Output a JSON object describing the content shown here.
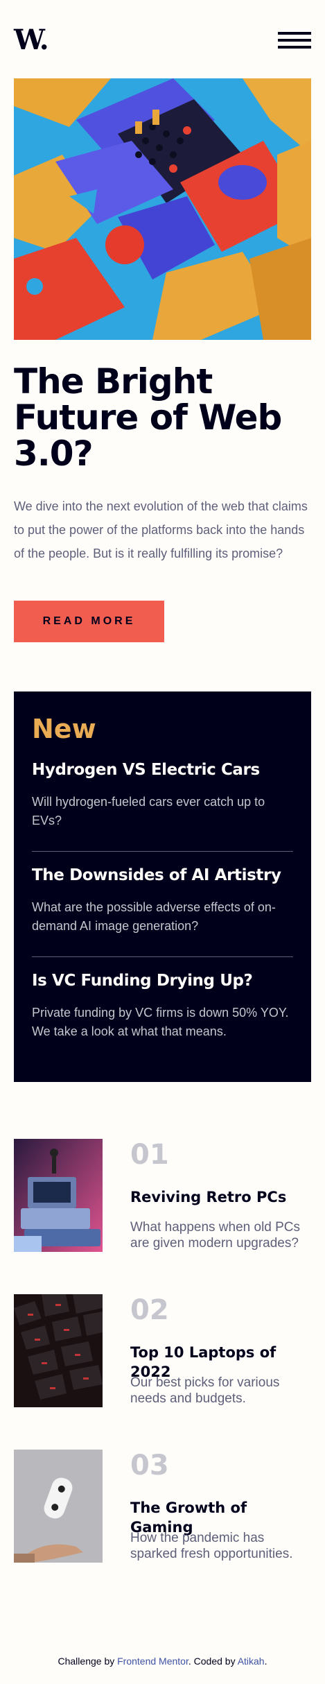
{
  "header": {
    "logo": "W."
  },
  "hero": {
    "title": "The Bright Future of Web 3.0?",
    "text": "We dive into the next evolution of the web that claims to put the power of the platforms back into the hands of the people. But is it really fulfilling its promise?",
    "button": "READ MORE"
  },
  "new": {
    "heading": "New",
    "items": [
      {
        "title": "Hydrogen VS Electric Cars",
        "text": "Will hydrogen-fueled cars ever catch up to EVs?"
      },
      {
        "title": "The Downsides of AI Artistry",
        "text": "What are the possible adverse effects of on-demand AI image generation?"
      },
      {
        "title": "Is VC Funding Drying Up?",
        "text": "Private funding by VC firms is down 50% YOY. We take a look at what that means."
      }
    ]
  },
  "cards": [
    {
      "num": "01",
      "title": "Reviving Retro PCs",
      "text": "What happens when old PCs are given modern upgrades?"
    },
    {
      "num": "02",
      "title": "Top 10 Laptops of 2022",
      "text": "Our best picks for various needs and budgets."
    },
    {
      "num": "03",
      "title": "The Growth of Gaming",
      "text": "How the pandemic has sparked fresh opportunities."
    }
  ],
  "footer": {
    "prefix": "Challenge by ",
    "mentor": "Frontend Mentor",
    "middle": ". Coded by ",
    "author": "Atikah",
    "suffix": "."
  }
}
